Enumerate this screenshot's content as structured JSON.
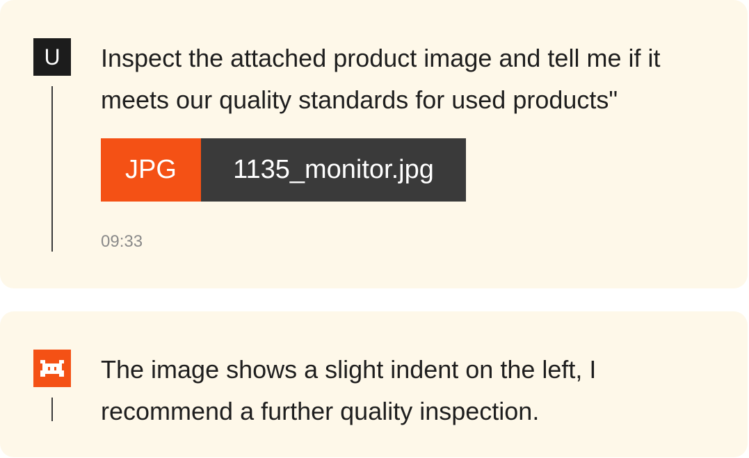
{
  "user_message": {
    "avatar_letter": "U",
    "text": "Inspect the attached product image and tell me if it meets our quality standards for used products\"",
    "attachment": {
      "type": "JPG",
      "filename": "1135_monitor.jpg"
    },
    "timestamp": "09:33"
  },
  "assistant_message": {
    "avatar_icon": "bot-logo-icon",
    "text": "The image shows a slight indent on the left, I recommend a further quality inspection."
  },
  "colors": {
    "card_background": "#fef8e9",
    "accent": "#f45115",
    "dark": "#1c1c1c",
    "attachment_name_background": "#3a3a3a",
    "text": "#1e1e1e",
    "muted": "#8a8a8a"
  }
}
